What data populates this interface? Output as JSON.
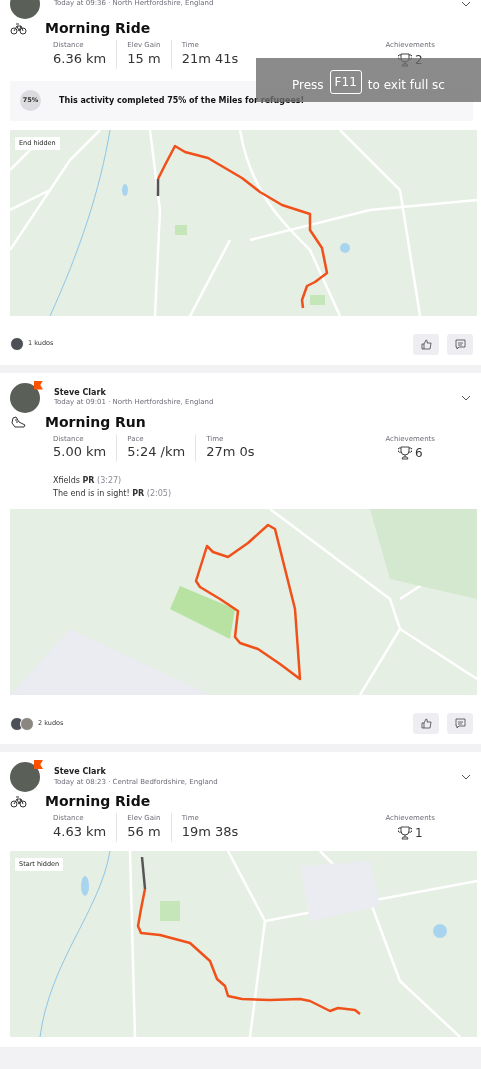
{
  "fullscreen_notice": {
    "before": "Press",
    "key": "F11",
    "after": "to exit full sc"
  },
  "activities": [
    {
      "meta": "Today at 09:36 · North Hertfordshire, England",
      "kind": "ride",
      "title": "Morning Ride",
      "stats": [
        {
          "label": "Distance",
          "value": "6.36 km"
        },
        {
          "label": "Elev Gain",
          "value": "15 m"
        },
        {
          "label": "Time",
          "value": "21m 41s"
        }
      ],
      "achievements": {
        "label": "Achievements",
        "count": "2"
      },
      "challenge": {
        "badge": "75%",
        "text": "This activity completed 75% of the Miles for refugees!"
      },
      "map": {
        "notice": "End hidden"
      },
      "kudos": {
        "text": "1 kudos",
        "givers": [
          {
            "kind": "photo"
          }
        ]
      }
    },
    {
      "athlete": "Steve Clark",
      "meta": "Today at 09:01 · North Hertfordshire, England",
      "kind": "run",
      "title": "Morning Run",
      "stats": [
        {
          "label": "Distance",
          "value": "5.00 km"
        },
        {
          "label": "Pace",
          "value": "5:24 /km"
        },
        {
          "label": "Time",
          "value": "27m 0s"
        }
      ],
      "achievements": {
        "label": "Achievements",
        "count": "6"
      },
      "segments": [
        {
          "name": "Xfields",
          "award": "PR",
          "time": "(3:27)"
        },
        {
          "name": "The end is in sight!",
          "award": "PR",
          "time": "(2:05)"
        }
      ],
      "map": {
        "kind": "route"
      },
      "kudos": {
        "text": "2 kudos",
        "givers": [
          {
            "kind": "photo"
          },
          {
            "kind": "photo"
          }
        ]
      }
    },
    {
      "athlete": "Steve Clark",
      "meta": "Today at 08:23 · Central Bedfordshire, England",
      "kind": "ride",
      "title": "Morning Ride",
      "stats": [
        {
          "label": "Distance",
          "value": "4.63 km"
        },
        {
          "label": "Elev Gain",
          "value": "56 m"
        },
        {
          "label": "Time",
          "value": "19m 38s"
        }
      ],
      "achievements": {
        "label": "Achievements",
        "count": "1"
      },
      "map": {
        "notice": "Start hidden"
      }
    }
  ]
}
